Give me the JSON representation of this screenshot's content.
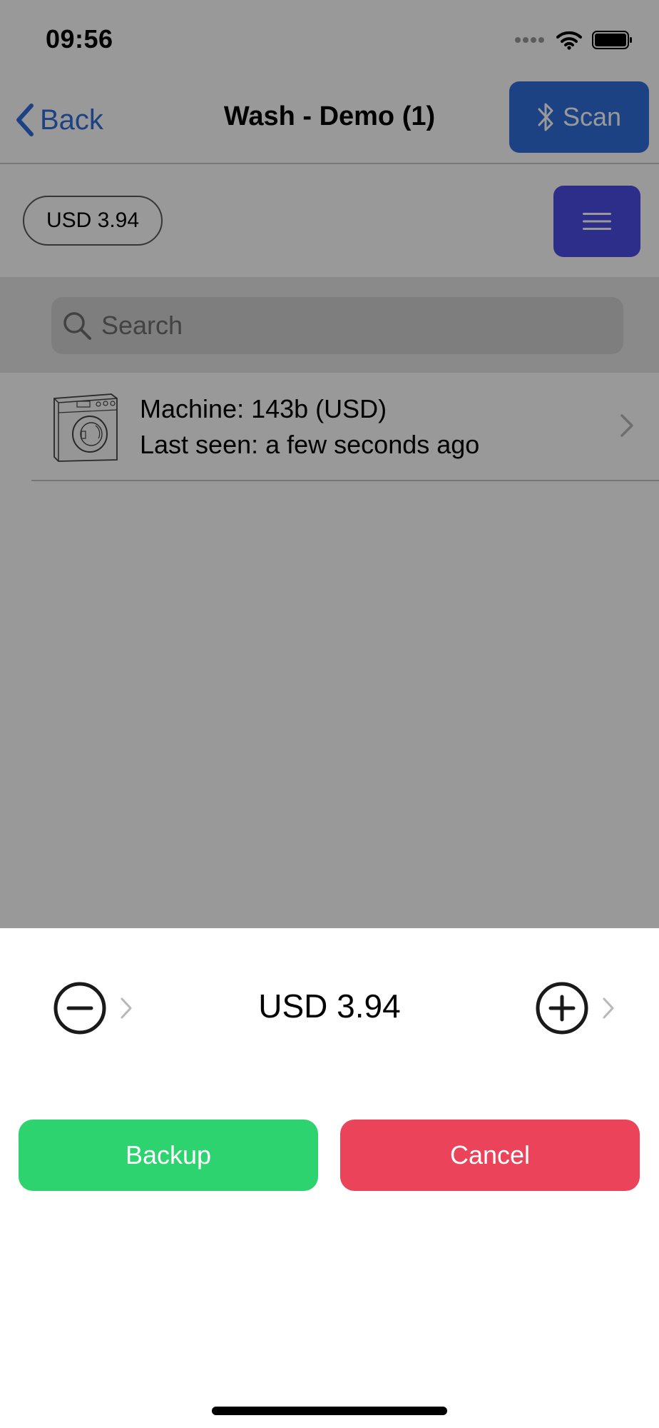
{
  "status_bar": {
    "time": "09:56",
    "icons": [
      "signal-dots-icon",
      "wifi-icon",
      "battery-icon"
    ]
  },
  "nav": {
    "back_label": "Back",
    "title": "Wash - Demo (1)",
    "scan_label": "Scan",
    "scan_icon": "bluetooth-icon"
  },
  "toolbar": {
    "balance": "USD 3.94",
    "menu_icon": "hamburger-menu-icon"
  },
  "search": {
    "placeholder": "Search"
  },
  "machines": [
    {
      "name_line": "Machine: 143b (USD)",
      "status_line": "Last seen: a few seconds ago",
      "icon": "washing-machine-icon"
    }
  ],
  "sheet": {
    "amount": "USD 3.94",
    "decrement_icon": "minus-circle-icon",
    "increment_icon": "plus-circle-icon",
    "backup_label": "Backup",
    "cancel_label": "Cancel"
  },
  "colors": {
    "accent_blue": "#2f6fdc",
    "menu_purple": "#4a4ee6",
    "backup_green": "#2dd36f",
    "cancel_red": "#eb445a"
  }
}
